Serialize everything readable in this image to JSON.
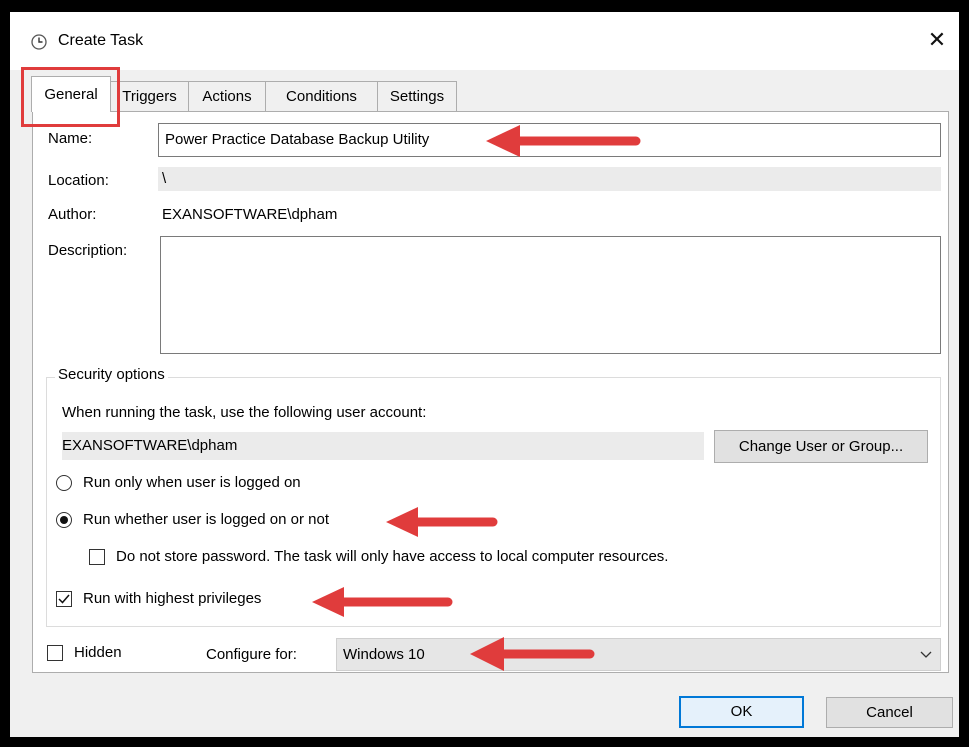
{
  "window": {
    "title": "Create Task",
    "close_symbol": "✕",
    "title_icon": "clock-icon"
  },
  "tabs": [
    {
      "label": "General",
      "active": true
    },
    {
      "label": "Triggers",
      "active": false
    },
    {
      "label": "Actions",
      "active": false
    },
    {
      "label": "Conditions",
      "active": false
    },
    {
      "label": "Settings",
      "active": false
    }
  ],
  "general": {
    "name_label": "Name:",
    "name_value": "Power Practice Database Backup Utility",
    "location_label": "Location:",
    "location_value": "\\",
    "author_label": "Author:",
    "author_value": "EXANSOFTWARE\\dpham",
    "description_label": "Description:",
    "description_value": ""
  },
  "security": {
    "legend": "Security options",
    "account_prompt": "When running the task, use the following user account:",
    "account_value": "EXANSOFTWARE\\dpham",
    "change_button": "Change User or Group...",
    "radio_logged_on": "Run only when user is logged on",
    "radio_whether": "Run whether user is logged on or not",
    "selected_radio": "radio_whether",
    "no_store_password": "Do not store password.  The task will only have access to local computer resources.",
    "no_store_password_checked": false,
    "highest_privileges": "Run with highest privileges",
    "highest_privileges_checked": true
  },
  "footer": {
    "hidden_label": "Hidden",
    "hidden_checked": false,
    "configure_label": "Configure for:",
    "configure_value": "Windows 10",
    "ok_button": "OK",
    "cancel_button": "Cancel"
  },
  "colors": {
    "annotation_red": "#e03c3c",
    "accent_blue": "#0078d7"
  }
}
